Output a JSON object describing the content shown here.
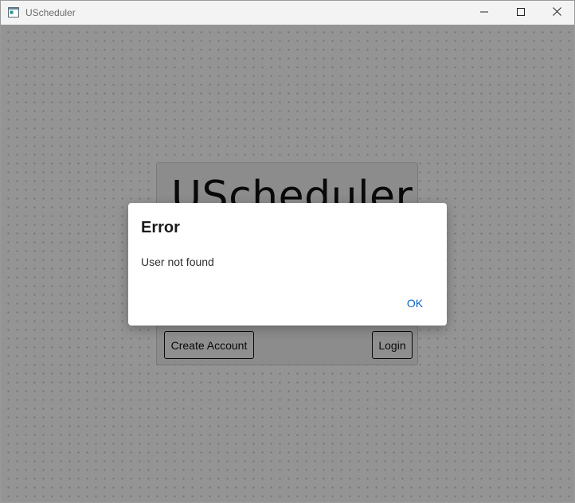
{
  "window": {
    "title": "UScheduler",
    "icons": {
      "app": "app-window-icon",
      "minimize": "minimize-icon",
      "maximize": "maximize-icon",
      "close": "close-icon"
    }
  },
  "login_card": {
    "title": "UScheduler",
    "create_account_label": "Create Account",
    "login_label": "Login"
  },
  "dialog": {
    "title": "Error",
    "message": "User not found",
    "ok_label": "OK"
  },
  "colors": {
    "accent": "#0b63c5",
    "overlay": "rgba(0,0,0,0.42)",
    "titlebar": "#f3f3f3"
  }
}
